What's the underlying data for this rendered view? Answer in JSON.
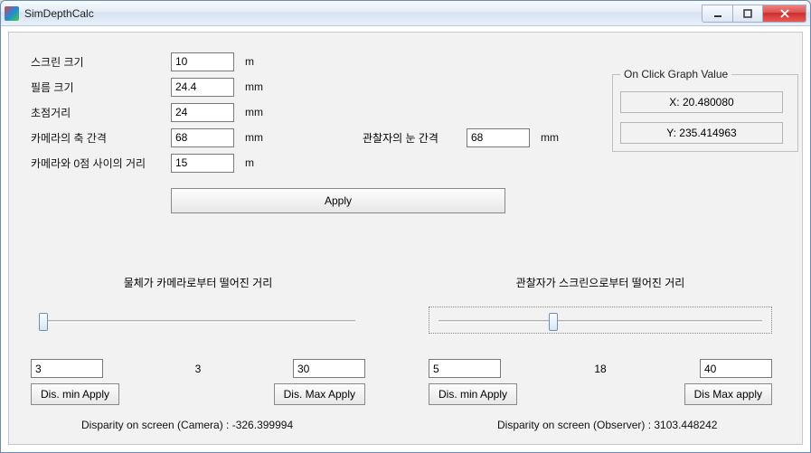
{
  "window": {
    "title": "SimDepthCalc"
  },
  "labels": {
    "screen_size": "스크린 크기",
    "film_size": "필름 크기",
    "focal_length": "초점거리",
    "camera_axis_gap": "카메라의 축 간격",
    "camera_zero_distance": "카메라와 0점 사이의 거리",
    "observer_eye_gap": "관찰자의 눈 간격"
  },
  "units": {
    "m": "m",
    "mm": "mm"
  },
  "values": {
    "screen_size": "10",
    "film_size": "24.4",
    "focal_length": "24",
    "camera_axis_gap": "68",
    "camera_zero_distance": "15",
    "observer_eye_gap": "68"
  },
  "buttons": {
    "apply": "Apply",
    "dis_min_apply": "Dis. min Apply",
    "dis_max_apply": "Dis. Max Apply",
    "dis_max_apply2": "Dis Max apply"
  },
  "group": {
    "title": "On Click Graph Value",
    "x": "X: 20.480080",
    "y": "Y: 235.414963"
  },
  "sliders": {
    "left": {
      "label": "물체가 카메라로부터 떨어진 거리",
      "min": "3",
      "value": "3",
      "max": "30"
    },
    "right": {
      "label": "관찰자가 스크린으로부터 떨어진 거리",
      "min": "5",
      "value": "18",
      "max": "40"
    }
  },
  "disparity": {
    "camera": "Disparity on screen (Camera) : -326.399994",
    "observer": "Disparity on screen (Observer) : 3103.448242"
  }
}
